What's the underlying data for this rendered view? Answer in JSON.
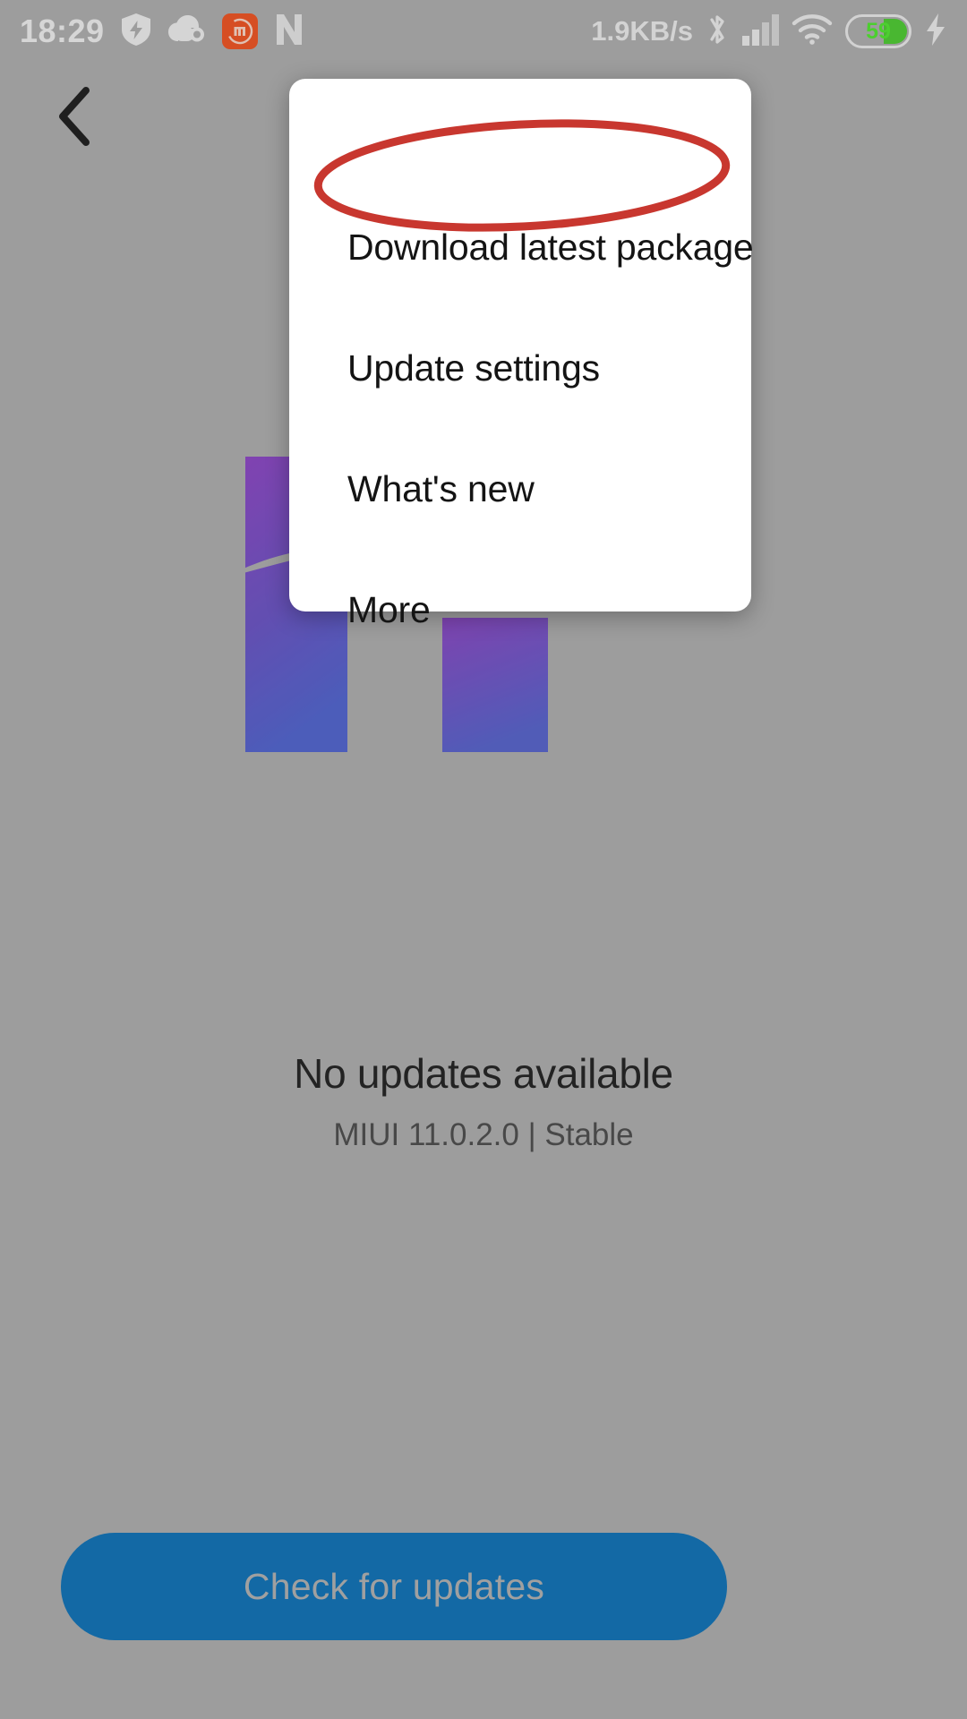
{
  "status_bar": {
    "clock": "18:29",
    "network_speed": "1.9KB/s",
    "battery_percent": "59",
    "icons": [
      "security-shield-icon",
      "cloud-sync-icon",
      "mi-app-icon",
      "nfc-icon",
      "bluetooth-icon",
      "cellular-signal-icon",
      "wifi-icon",
      "battery-icon",
      "charging-bolt-icon"
    ]
  },
  "navigation": {
    "back_label": "Back"
  },
  "main": {
    "status_title": "No updates available",
    "version_line": "MIUI 11.0.2.0 | Stable",
    "primary_button": "Check for updates"
  },
  "popup_menu": {
    "items": [
      {
        "label": "Download latest package",
        "highlighted": true
      },
      {
        "label": "Update settings",
        "highlighted": false
      },
      {
        "label": "What's new",
        "highlighted": false
      },
      {
        "label": "More",
        "highlighted": false
      }
    ]
  },
  "annotation": {
    "shape": "ellipse",
    "target": "Download latest package",
    "color": "#c8372f"
  },
  "colors": {
    "background": "#b0b0b0",
    "dialog": "#ffffff",
    "primary_button": "#0b72b9",
    "annotation_red": "#c8372f",
    "battery_green": "#4ccf2f",
    "mi_orange": "#f4511e",
    "illustration_purple_top": "#8e44c8",
    "illustration_purple_bottom": "#4f5fd0"
  }
}
